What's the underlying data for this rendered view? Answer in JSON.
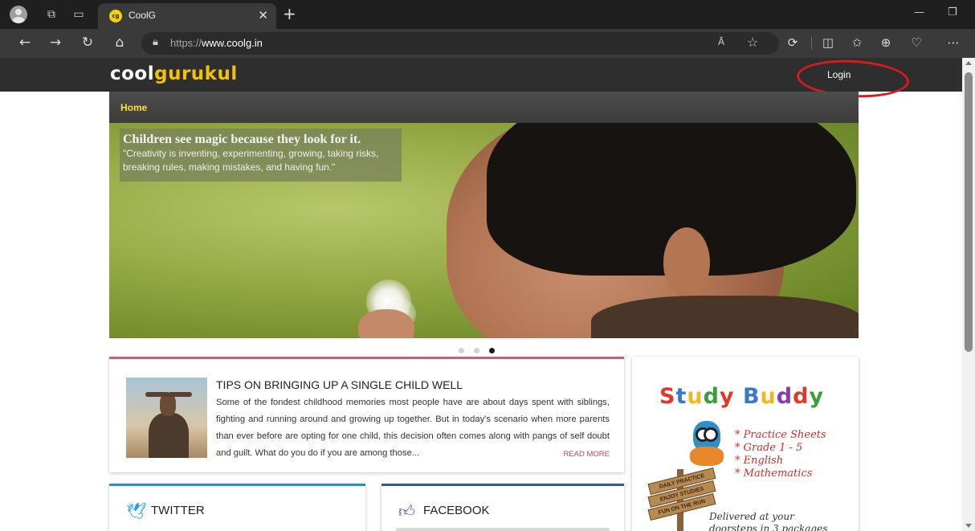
{
  "browser": {
    "tab_title": "CoolG",
    "tab_favicon_text": "cg",
    "url_prefix": "https://",
    "url_host": "www.coolg.in",
    "reader_label": "Ă"
  },
  "site": {
    "logo_part1": "cool",
    "logo_part2": "gurukul",
    "login_label": "Login",
    "nav_home": "Home"
  },
  "hero": {
    "headline": "Children see magic because they look for it.",
    "quote": "\"Creativity is inventing, experimenting, growing, taking risks, breaking rules, making mistakes, and having fun.\"",
    "slide_count": 3,
    "active_slide": 3
  },
  "article": {
    "title": "TIPS ON BRINGING UP A SINGLE CHILD WELL",
    "body": "Some of the fondest childhood memories most people have are about days spent with siblings, fighting and running around and growing up together. But in today's scenario when more parents than ever before are opting for one child, this decision often comes along with pangs of self doubt and guilt.  What do you do if you are among those...",
    "read_more": "READ MORE"
  },
  "ad": {
    "brand": "Study Buddy",
    "features": [
      "* Practice Sheets",
      "* Grade 1 - 5",
      "* English",
      "* Mathematics"
    ],
    "signs": [
      "DAILY PRACTICE",
      "ENJOY STUDIES",
      "FUN ON THE RUN"
    ],
    "delivery_line1": "Delivered at your",
    "delivery_line2": "doorsteps in 3 packages"
  },
  "social": {
    "twitter_label": "TWITTER",
    "facebook_label": "FACEBOOK"
  },
  "colors": {
    "header_bg": "#2e2e2e",
    "logo_accent": "#f2c300",
    "nav_home": "#ffe33a",
    "login_highlight": "#d41c1c",
    "article_border": "#c0647a",
    "twitter_border": "#2a8ec8",
    "facebook_border": "#3a5795"
  }
}
